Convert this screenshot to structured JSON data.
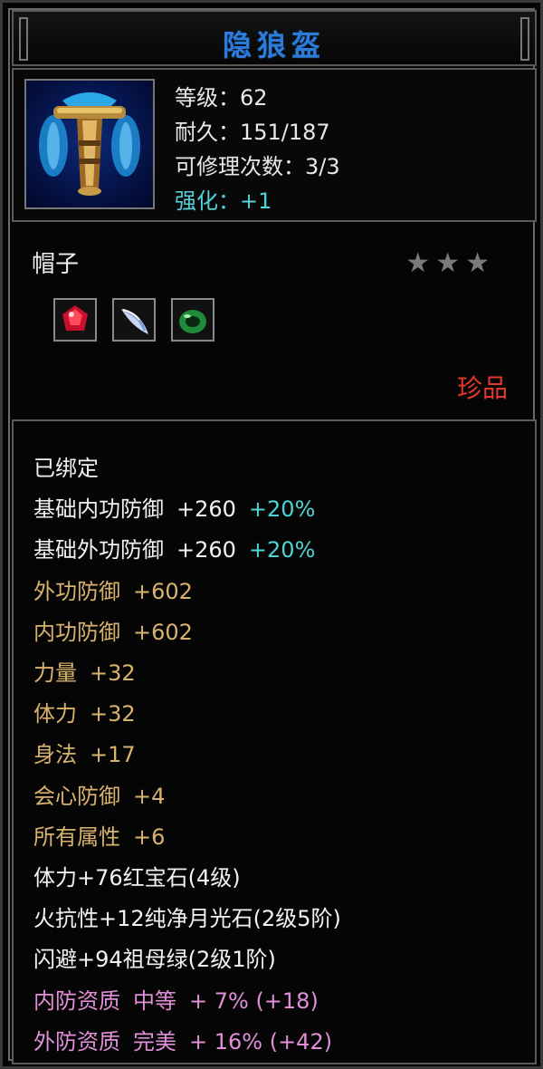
{
  "item_name": "隐狼盔",
  "icon": "helmet-icon",
  "stats": {
    "level": "等级：62",
    "durability": "耐久：151/187",
    "repair": "可修理次数：3/3",
    "enhance": "强化：+1"
  },
  "item_type": "帽子",
  "stars": [
    "★",
    "★",
    "★"
  ],
  "gems": [
    {
      "icon": "ruby-gem-icon"
    },
    {
      "icon": "moonstone-gem-icon"
    },
    {
      "icon": "emerald-gem-icon"
    }
  ],
  "quality": "珍品",
  "bound": "已绑定",
  "attributes": [
    {
      "label": "基础内功防御",
      "value": "+260",
      "extra": "+20%",
      "color": "white"
    },
    {
      "label": "基础外功防御",
      "value": "+260",
      "extra": "+20%",
      "color": "white"
    },
    {
      "label": "外功防御",
      "value": "+602",
      "color": "gold"
    },
    {
      "label": "内功防御",
      "value": "+602",
      "color": "gold"
    },
    {
      "label": "力量",
      "value": "+32",
      "color": "gold"
    },
    {
      "label": "体力",
      "value": "+32",
      "color": "gold"
    },
    {
      "label": "身法",
      "value": "+17",
      "color": "gold"
    },
    {
      "label": "会心防御",
      "value": "+4",
      "color": "gold"
    },
    {
      "label": "所有属性",
      "value": "+6",
      "color": "gold"
    }
  ],
  "gem_bonuses": [
    "体力+76红宝石(4级)",
    "火抗性+12纯净月光石(2级5阶)",
    "闪避+94祖母绿(2级1阶)"
  ],
  "qualities": [
    {
      "label": "内防资质",
      "grade": "中等",
      "value": "+ 7% (+18)"
    },
    {
      "label": "外防资质",
      "grade": "完美",
      "value": "+ 16% (+42)"
    }
  ],
  "colors": {
    "title": "#2d7dd8",
    "quality": "#e0392b",
    "enhance": "#54d0d8",
    "gold": "#d9b36e",
    "pink": "#e08fd8"
  }
}
